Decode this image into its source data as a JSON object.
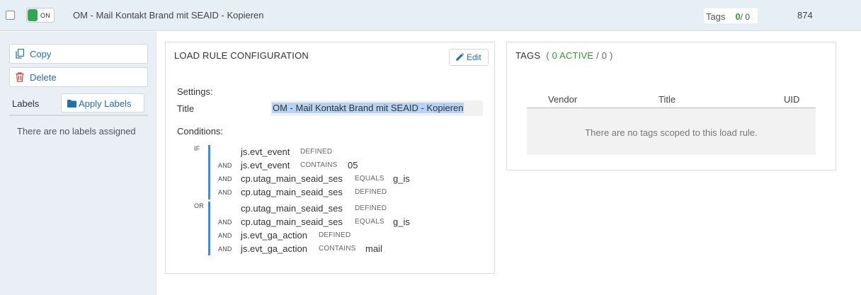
{
  "header": {
    "toggle_label": "ON",
    "rule_title": "OM - Mail Kontakt Brand mit SEAID - Kopieren",
    "tags_label": "Tags",
    "tags_active": "0",
    "tags_total": "/ 0",
    "uid": "874"
  },
  "sidebar": {
    "copy_label": "Copy",
    "delete_label": "Delete",
    "labels_heading": "Labels",
    "apply_labels": "Apply Labels",
    "no_labels": "There are no labels assigned"
  },
  "config": {
    "heading": "LOAD RULE CONFIGURATION",
    "edit_label": "Edit",
    "settings_label": "Settings:",
    "title_label": "Title",
    "title_value": "OM - Mail Kontakt Brand mit SEAID - Kopieren",
    "conditions_label": "Conditions:",
    "groups": [
      {
        "op": "IF",
        "rows": [
          {
            "op": "",
            "variable": "js.evt_event",
            "operator": "DEFINED",
            "value": ""
          },
          {
            "op": "AND",
            "variable": "js.evt_event",
            "operator": "CONTAINS",
            "value": "05"
          },
          {
            "op": "AND",
            "variable": "cp.utag_main_seaid_ses",
            "operator": "EQUALS",
            "value": "g_is"
          },
          {
            "op": "AND",
            "variable": "cp.utag_main_seaid_ses",
            "operator": "DEFINED",
            "value": ""
          }
        ]
      },
      {
        "op": "OR",
        "rows": [
          {
            "op": "",
            "variable": "cp.utag_main_seaid_ses",
            "operator": "DEFINED",
            "value": ""
          },
          {
            "op": "AND",
            "variable": "cp.utag_main_seaid_ses",
            "operator": "EQUALS",
            "value": "g_is"
          },
          {
            "op": "AND",
            "variable": "js.evt_ga_action",
            "operator": "DEFINED",
            "value": ""
          },
          {
            "op": "AND",
            "variable": "js.evt_ga_action",
            "operator": "CONTAINS",
            "value": "mail"
          }
        ]
      }
    ]
  },
  "tags_panel": {
    "heading": "TAGS",
    "paren_open": "(",
    "active_text": "0 ACTIVE",
    "total_text": "/ 0 )",
    "columns": [
      "Vendor",
      "Title",
      "UID"
    ],
    "empty_message": "There are no tags scoped to this load rule."
  },
  "colors": {
    "accent_blue": "#1f6fb5",
    "active_green": "#2ca02c",
    "condition_bar": "#3b8fd6",
    "header_bg": "#e6eef6"
  },
  "icons": {
    "copy": "copy-icon",
    "delete": "trash-icon",
    "apply_labels": "folder-icon",
    "edit": "pencil-icon"
  }
}
